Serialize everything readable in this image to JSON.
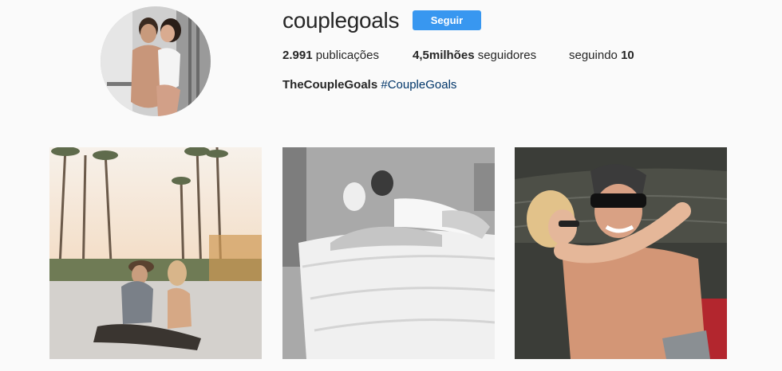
{
  "profile": {
    "username": "couplegoals",
    "follow_label": "Seguir",
    "avatar_icon": "profile-photo-icon"
  },
  "stats": {
    "posts_count": "2.991",
    "posts_label": "publicações",
    "followers_count": "4,5milhões",
    "followers_label": "seguidores",
    "following_label": "seguindo",
    "following_count": "10"
  },
  "bio": {
    "full_name": "TheCoupleGoals",
    "hashtag": "#CoupleGoals"
  },
  "colors": {
    "accent": "#3897f0",
    "link": "#003569",
    "background": "#fafafa"
  }
}
